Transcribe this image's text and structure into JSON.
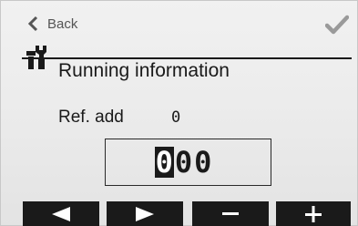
{
  "nav": {
    "back_label": "Back",
    "back_icon": "chevron-left-icon",
    "confirm_icon": "checkmark-icon"
  },
  "header": {
    "icon": "tools-icon",
    "title": "Running information"
  },
  "content": {
    "ref_label": "Ref. add",
    "ref_value": "0"
  },
  "editor": {
    "digits": [
      "0",
      "0",
      "0"
    ],
    "selected_index": 0
  },
  "softkeys": [
    {
      "icon": "arrow-left-icon"
    },
    {
      "icon": "arrow-right-icon"
    },
    {
      "icon": "minus-icon"
    },
    {
      "icon": "plus-icon"
    }
  ],
  "colors": {
    "background": "#ececec",
    "text": "#1a1a1a",
    "softkey": "#1a1a1a",
    "muted": "#555555",
    "check": "#9a9a9a"
  }
}
